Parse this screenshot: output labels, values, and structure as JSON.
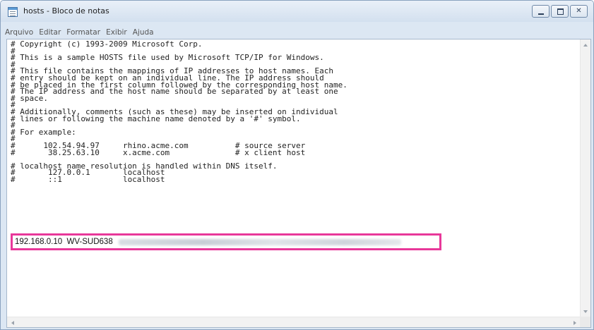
{
  "window": {
    "title": "hosts - Bloco de notas",
    "minimize_label": "",
    "maximize_label": "",
    "close_label": "✕"
  },
  "menu": [
    "Arquivo",
    "Editar",
    "Formatar",
    "Exibir",
    "Ajuda"
  ],
  "document": {
    "lines": [
      "# Copyright (c) 1993-2009 Microsoft Corp.",
      "#",
      "# This is a sample HOSTS file used by Microsoft TCP/IP for Windows.",
      "#",
      "# This file contains the mappings of IP addresses to host names. Each",
      "# entry should be kept on an individual line. The IP address should",
      "# be placed in the first column followed by the corresponding host name.",
      "# The IP address and the host name should be separated by at least one",
      "# space.",
      "#",
      "# Additionally, comments (such as these) may be inserted on individual",
      "# lines or following the machine name denoted by a '#' symbol.",
      "#",
      "# For example:",
      "#",
      "#      102.54.94.97     rhino.acme.com          # source server",
      "#       38.25.63.10     x.acme.com              # x client host",
      "",
      "# localhost name resolution is handled within DNS itself.",
      "#       127.0.0.1       localhost",
      "#       ::1             localhost"
    ],
    "host_entry": "192.168.0.10  WV-SUD638"
  }
}
